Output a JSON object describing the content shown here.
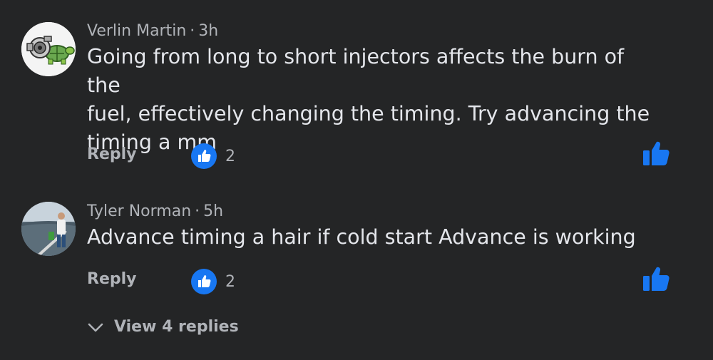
{
  "comments": [
    {
      "author": "Verlin Martin",
      "time": "3h",
      "text_lines": [
        "Going from long to short injectors affects the burn of the",
        "fuel, effectively changing the timing. Try advancing the",
        "timing a mm"
      ],
      "reply_label": "Reply",
      "like_count": "2",
      "avatar_icon": "turtle-turbo-avatar"
    },
    {
      "author": "Tyler Norman",
      "time": "5h",
      "text_lines": [
        "Advance timing a hair if cold start Advance is working"
      ],
      "reply_label": "Reply",
      "like_count": "2",
      "avatar_icon": "person-on-dock-avatar"
    }
  ],
  "view_replies_label": "View 4 replies",
  "colors": {
    "background": "#242526",
    "primary_text": "#e4e6eb",
    "secondary_text": "#b0b3b8",
    "like_blue": "#1877f2"
  }
}
